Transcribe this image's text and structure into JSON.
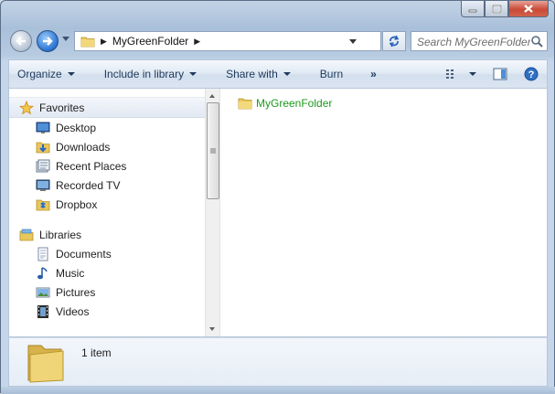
{
  "window": {
    "caption_buttons": [
      "minimize",
      "maximize",
      "close"
    ]
  },
  "nav": {
    "breadcrumb": [
      "MyGreenFolder"
    ],
    "search_placeholder": "Search MyGreenFolder"
  },
  "toolbar": {
    "organize": "Organize",
    "include_in_library": "Include in library",
    "share_with": "Share with",
    "burn": "Burn",
    "more": "»"
  },
  "sidebar": {
    "favorites": {
      "label": "Favorites",
      "items": [
        {
          "label": "Desktop",
          "icon": "desktop-icon"
        },
        {
          "label": "Downloads",
          "icon": "downloads-icon"
        },
        {
          "label": "Recent Places",
          "icon": "recent-places-icon"
        },
        {
          "label": "Recorded TV",
          "icon": "recorded-tv-icon"
        },
        {
          "label": "Dropbox",
          "icon": "dropbox-icon"
        }
      ]
    },
    "libraries": {
      "label": "Libraries",
      "items": [
        {
          "label": "Documents",
          "icon": "documents-icon"
        },
        {
          "label": "Music",
          "icon": "music-icon"
        },
        {
          "label": "Pictures",
          "icon": "pictures-icon"
        },
        {
          "label": "Videos",
          "icon": "videos-icon"
        }
      ]
    }
  },
  "files": [
    {
      "name": "MyGreenFolder",
      "type": "folder",
      "color": "#1d9a1d"
    }
  ],
  "details": {
    "count": "1 item"
  },
  "colors": {
    "folder_name_text": "#1d9a1d",
    "toolbar_text": "#1e395b",
    "close_button": "#c94a36"
  }
}
